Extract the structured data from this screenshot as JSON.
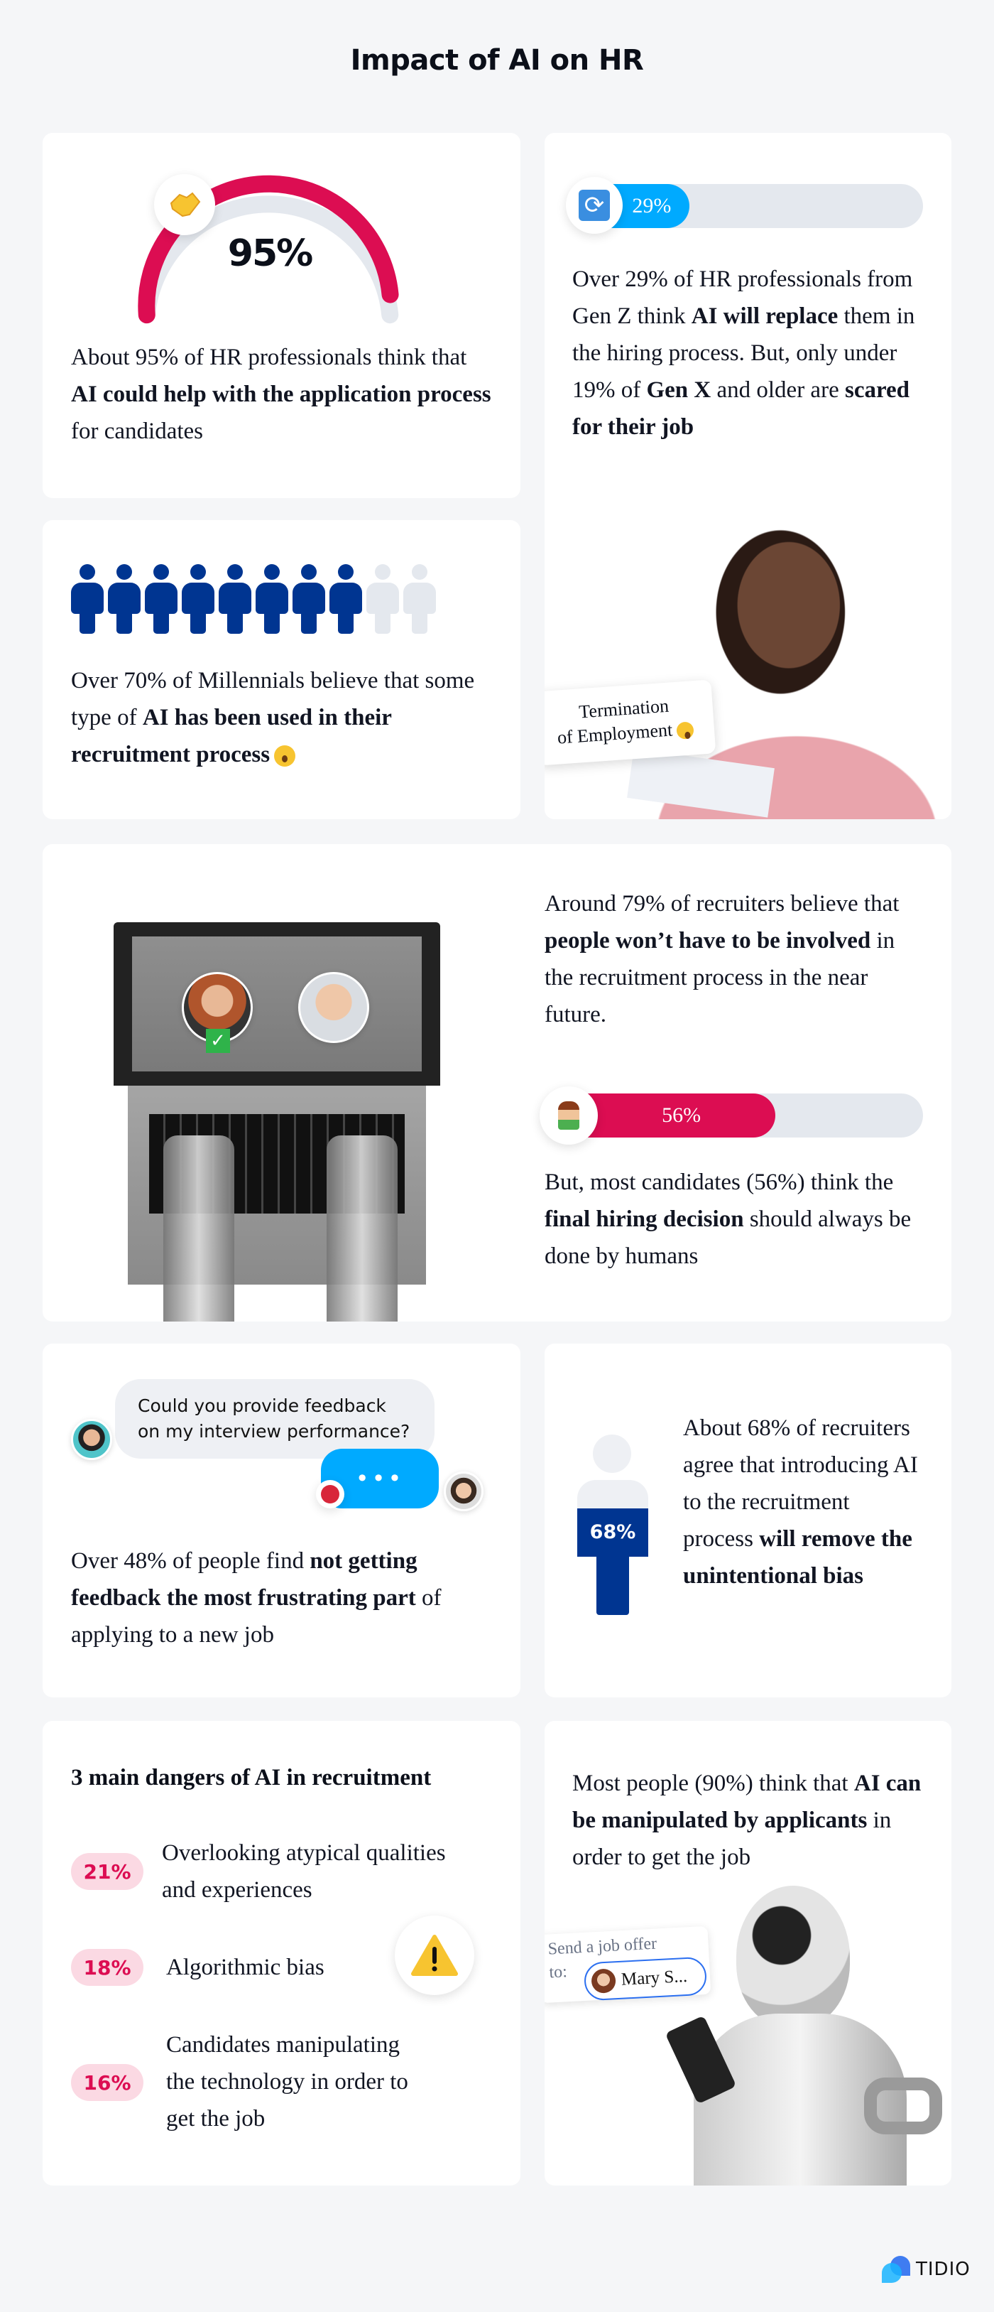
{
  "title": "Impact of AI on HR",
  "colors": {
    "crimson": "#dc0d52",
    "blue": "#00aaff",
    "navy": "#003591",
    "track": "#e4e8ee",
    "background": "#f5f6f8"
  },
  "card_gauge": {
    "value_label": "95%",
    "value_percent": 95,
    "icon": "handshake-icon",
    "text": [
      {
        "t": "About 95% of HR professionals think that "
      },
      {
        "t": "AI could help with the application process",
        "b": true
      },
      {
        "t": " for candidates"
      }
    ]
  },
  "card_millennials": {
    "icons_filled": 8,
    "icons_total": 10,
    "text": [
      {
        "t": "Over 70% of Millennials believe that some type of "
      },
      {
        "t": "AI has been used in their recruitment process",
        "b": true
      }
    ],
    "emoji": "surprised-face-icon"
  },
  "card_genz": {
    "bar_label": "29%",
    "bar_percent": 29,
    "icon": "refresh-icon",
    "text": [
      {
        "t": "Over 29% of HR professionals from Gen Z think "
      },
      {
        "t": "AI will replace",
        "b": true
      },
      {
        "t": " them in the hiring process. But, only under 19% of "
      },
      {
        "t": "Gen X",
        "b": true
      },
      {
        "t": " and older are "
      },
      {
        "t": "scared for their job",
        "b": true
      }
    ],
    "bubble_line1": "Termination",
    "bubble_line2": "of Employment"
  },
  "card_recruiters": {
    "text": [
      {
        "t": "Around 79% of recruiters believe that "
      },
      {
        "t": "people won’t have to be involved",
        "b": true
      },
      {
        "t": " in the recruitment process in the near future."
      }
    ],
    "bar_label": "56%",
    "bar_percent": 56,
    "icon": "support-agent-icon",
    "text2": [
      {
        "t": "But, most candidates (56%) think the "
      },
      {
        "t": "final hiring decision",
        "b": true
      },
      {
        "t": " should always be done by humans"
      }
    ]
  },
  "card_feedback": {
    "chat_message_line1": "Could you provide feedback",
    "chat_message_line2": "on my interview performance?",
    "typing": "•••",
    "text": [
      {
        "t": "Over 48% of people find "
      },
      {
        "t": "not getting feedback the most frustrating part",
        "b": true
      },
      {
        "t": " of applying to a new job"
      }
    ]
  },
  "card_bias": {
    "figure_label": "68%",
    "text": [
      {
        "t": "About 68% of recruiters agree that introducing AI to the recruitment process "
      },
      {
        "t": "will remove the unintentional bias",
        "b": true
      }
    ]
  },
  "card_dangers": {
    "heading": "3 main dangers of AI in recruitment",
    "items": [
      {
        "percent": "21%",
        "line1": "Overlooking atypical qualities",
        "line2": "and experiences",
        "line3": ""
      },
      {
        "percent": "18%",
        "line1": "Algorithmic bias",
        "line2": "",
        "line3": ""
      },
      {
        "percent": "16%",
        "line1": "Candidates manipulating",
        "line2": "the technology in order to",
        "line3": "get the job"
      }
    ],
    "icon": "warning-icon"
  },
  "card_manipulated": {
    "text": [
      {
        "t": "Most people (90%) think that "
      },
      {
        "t": "AI can be manipulated by applicants",
        "b": true
      },
      {
        "t": " in order to get the job"
      }
    ],
    "offer_label": "Send a job offer",
    "offer_to": "to:",
    "offer_recipient": "Mary S..."
  },
  "brand": {
    "name": "TIDIO"
  }
}
